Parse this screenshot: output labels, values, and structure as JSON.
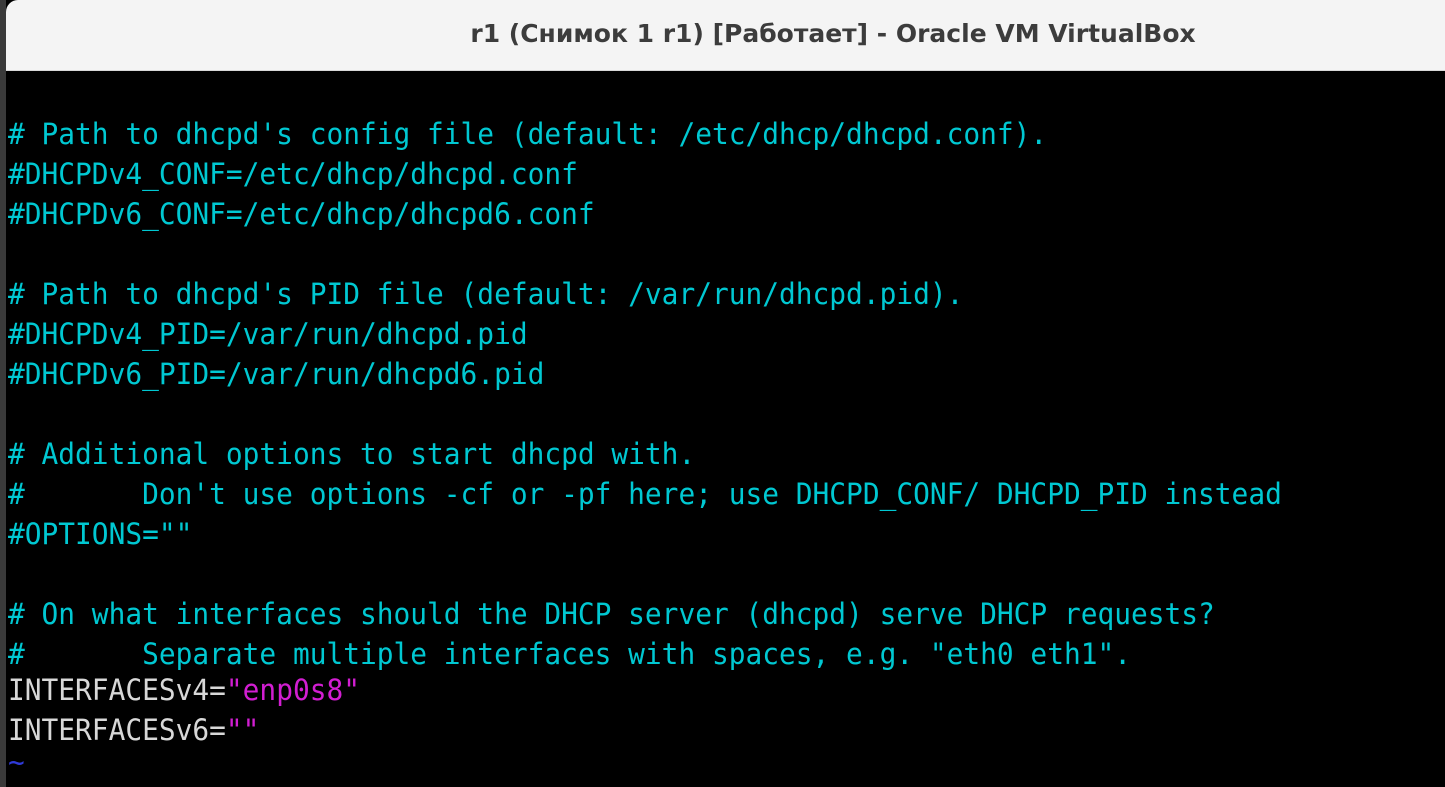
{
  "window": {
    "title": "r1 (Снимок 1 r1) [Работает] - Oracle VM VirtualBox"
  },
  "terminal": {
    "lines": [
      "# Path to dhcpd's config file (default: /etc/dhcp/dhcpd.conf).",
      "#DHCPDv4_CONF=/etc/dhcp/dhcpd.conf",
      "#DHCPDv6_CONF=/etc/dhcp/dhcpd6.conf",
      "",
      "# Path to dhcpd's PID file (default: /var/run/dhcpd.pid).",
      "#DHCPDv4_PID=/var/run/dhcpd.pid",
      "#DHCPDv6_PID=/var/run/dhcpd6.pid",
      "",
      "# Additional options to start dhcpd with.",
      "#       Don't use options -cf or -pf here; use DHCPD_CONF/ DHCPD_PID instead",
      "#OPTIONS=\"\"",
      "",
      "# On what interfaces should the DHCP server (dhcpd) serve DHCP requests?",
      "#       Separate multiple interfaces with spaces, e.g. \"eth0 eth1\"."
    ],
    "iface_v4_key": "INTERFACESv4=",
    "iface_v4_value": "\"enp0s8\"",
    "iface_v6_key": "INTERFACESv6=",
    "iface_v6_value": "\"\"",
    "tilde": "~"
  },
  "colors": {
    "comment": "#00c8d2",
    "keyword": "#d8d8d8",
    "string": "#d21ed2",
    "tilde": "#2f3ad8",
    "background": "#000000",
    "titlebar": "#f4f4f4"
  }
}
